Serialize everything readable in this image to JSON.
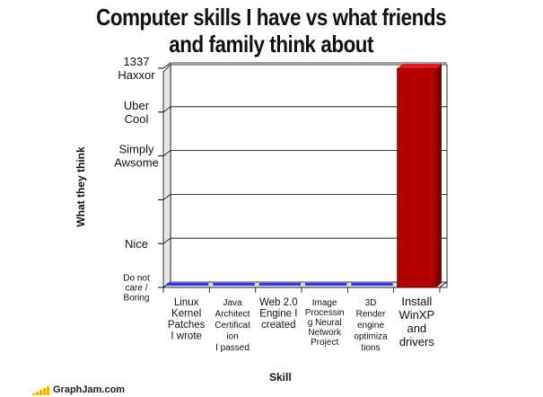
{
  "header": {
    "title_line1": "Computer skills I have vs what friends",
    "title_line2": "and family think about"
  },
  "footer": {
    "site": "GraphJam.com"
  },
  "colors": {
    "series": "#3333ff",
    "highlight": "#cc0000",
    "grid": "#000000"
  },
  "chart_data": {
    "type": "bar",
    "title": "Computer skills I have vs what friends and family think about",
    "xlabel": "Skill",
    "ylabel": "What they think",
    "ylim": [
      0,
      5
    ],
    "grid": true,
    "y_ticks": [
      {
        "value": 0,
        "label": [
          "Do not",
          "care /",
          "Boring"
        ]
      },
      {
        "value": 1,
        "label": [
          "Nice"
        ]
      },
      {
        "value": 2,
        "label": [
          ""
        ]
      },
      {
        "value": 3,
        "label": [
          "Simply",
          "Awsome"
        ]
      },
      {
        "value": 4,
        "label": [
          "Uber",
          "Cool"
        ]
      },
      {
        "value": 5,
        "label": [
          "1337",
          "Haxxor"
        ]
      }
    ],
    "categories": [
      [
        "Linux",
        "Kernel",
        "Patches",
        "I wrote"
      ],
      [
        "Java",
        "Architect",
        "Certificat",
        "ion",
        "I passed"
      ],
      [
        "Web 2.0",
        "Engine I",
        "created"
      ],
      [
        "Image",
        "Processin",
        "g Neural",
        "Network",
        "Project"
      ],
      [
        "3D",
        "Render",
        "engine",
        "optimiza",
        "tions"
      ],
      [
        "Install",
        "WinXP",
        "and",
        "drivers"
      ]
    ],
    "values": [
      0,
      0,
      0,
      0,
      0,
      5
    ]
  }
}
